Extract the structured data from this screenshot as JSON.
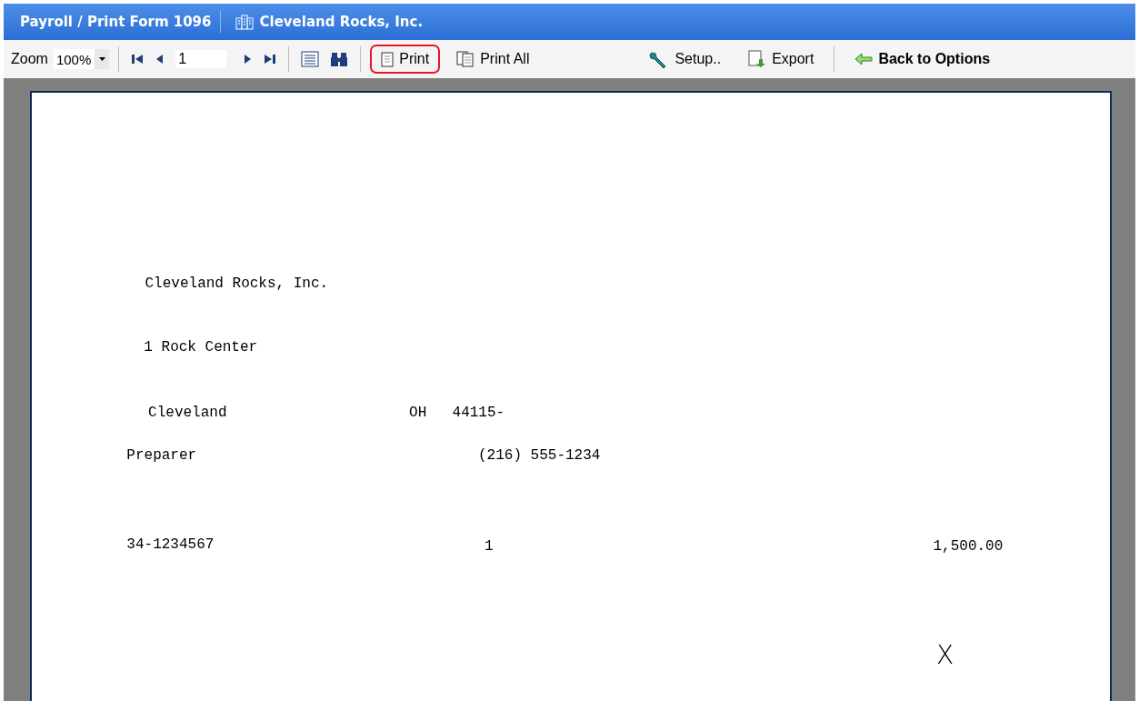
{
  "title_bar": {
    "breadcrumb": "Payroll / Print Form 1096",
    "company": "Cleveland Rocks, Inc."
  },
  "toolbar": {
    "zoom_label": "Zoom",
    "zoom_value": "100%",
    "page_number": "1",
    "buttons": [
      {
        "kind": "print",
        "label": "Print",
        "highlighted": true
      },
      {
        "kind": "print-all",
        "label": "Print All",
        "highlighted": false
      },
      {
        "kind": "setup",
        "label": "Setup..",
        "highlighted": false
      },
      {
        "kind": "export",
        "label": "Export",
        "highlighted": false
      },
      {
        "kind": "back",
        "label": "Back to Options",
        "highlighted": false
      }
    ]
  },
  "form": {
    "payer_name": "Cleveland Rocks, Inc.",
    "street": "1 Rock Center",
    "city": "Cleveland",
    "state": "OH",
    "zip": "44115-",
    "contact": "Preparer",
    "phone": "(216) 555-1234",
    "ein": "34-1234567",
    "forms_count": "1",
    "total": "1,500.00",
    "mark": "X"
  }
}
